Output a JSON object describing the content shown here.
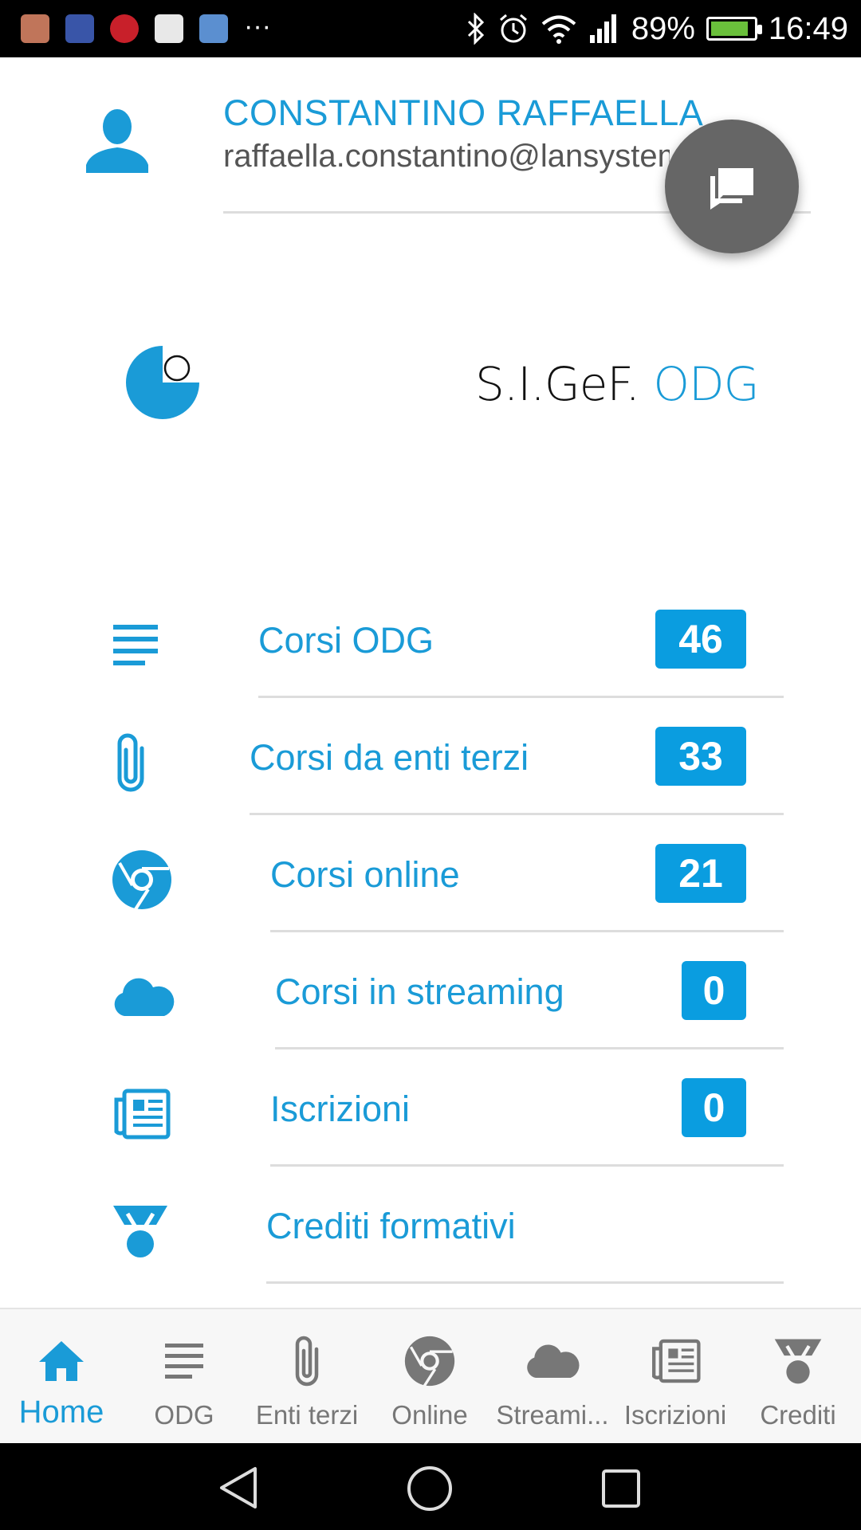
{
  "status_bar": {
    "battery_percent": "89%",
    "battery_level": 0.89,
    "time": "16:49",
    "notification_icons": [
      "inbox-icon",
      "usb-icon",
      "music-app-icon",
      "app-thumbnail-icon",
      "files-app-icon"
    ],
    "more": "···"
  },
  "profile": {
    "name": "CONSTANTINO RAFFAELLA",
    "email": "raffaella.constantino@lansystems"
  },
  "brand": {
    "prefix": "S.I.GeF.",
    "suffix": "ODG"
  },
  "menu": [
    {
      "label": "Corsi ODG",
      "count": "46",
      "icon": "list-icon"
    },
    {
      "label": "Corsi da enti terzi",
      "count": "33",
      "icon": "paperclip-icon"
    },
    {
      "label": "Corsi online",
      "count": "21",
      "icon": "chrome-icon"
    },
    {
      "label": "Corsi in streaming",
      "count": "0",
      "icon": "cloud-icon"
    },
    {
      "label": "Iscrizioni",
      "count": "0",
      "icon": "newspaper-icon"
    },
    {
      "label": "Crediti formativi",
      "count": "",
      "icon": "medal-icon"
    }
  ],
  "bottom_nav": [
    {
      "label": "Home",
      "icon": "home-icon",
      "active": true
    },
    {
      "label": "ODG",
      "icon": "list-icon"
    },
    {
      "label": "Enti terzi",
      "icon": "paperclip-icon"
    },
    {
      "label": "Online",
      "icon": "chrome-icon"
    },
    {
      "label": "Streami...",
      "icon": "cloud-icon"
    },
    {
      "label": "Iscrizioni",
      "icon": "newspaper-icon"
    },
    {
      "label": "Crediti",
      "icon": "medal-icon"
    }
  ],
  "colors": {
    "accent": "#1a9bd7",
    "badge": "#0a9de0",
    "fab": "#666666",
    "inactive": "#777777"
  }
}
